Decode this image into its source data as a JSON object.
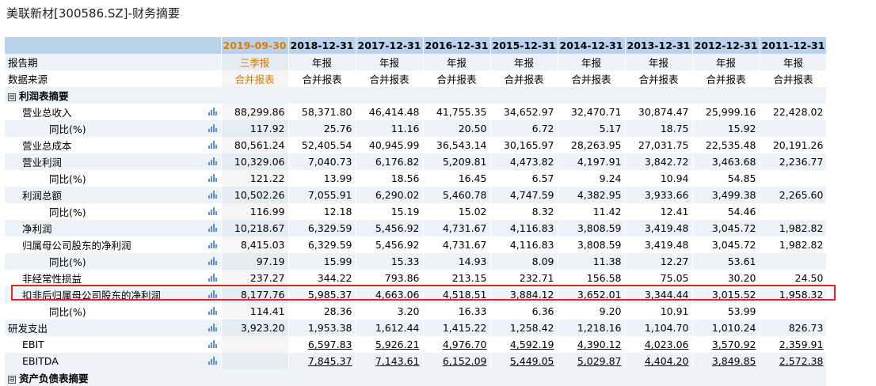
{
  "title": "美联新材[300586.SZ]-财务摘要",
  "columns": {
    "dates": [
      "2019-09-30",
      "2018-12-31",
      "2017-12-31",
      "2016-12-31",
      "2015-12-31",
      "2014-12-31",
      "2013-12-31",
      "2012-12-31",
      "2011-12-31"
    ],
    "report_label": "报告期",
    "report_types": [
      "三季报",
      "年报",
      "年报",
      "年报",
      "年报",
      "年报",
      "年报",
      "年报",
      "年报"
    ],
    "source_label": "数据来源",
    "sources": [
      "合并报表",
      "合并报表",
      "合并报表",
      "合并报表",
      "合并报表",
      "合并报表",
      "合并报表",
      "合并报表",
      "合并报表"
    ]
  },
  "sections": {
    "income": "利润表摘要",
    "balance": "资产负债表摘要"
  },
  "toggle_symbol": "⊟",
  "rows": [
    {
      "label": "营业总收入",
      "values": [
        "88,299.86",
        "58,371.80",
        "46,414.48",
        "41,755.35",
        "34,652.97",
        "32,470.71",
        "30,874.47",
        "25,999.16",
        "22,428.02"
      ]
    },
    {
      "label": "同比(%)",
      "values": [
        "117.92",
        "25.76",
        "11.16",
        "20.50",
        "6.72",
        "5.17",
        "18.75",
        "15.92",
        ""
      ]
    },
    {
      "label": "营业总成本",
      "values": [
        "80,561.24",
        "52,405.54",
        "40,945.99",
        "36,543.14",
        "30,165.97",
        "28,263.95",
        "27,031.75",
        "22,535.48",
        "20,191.26"
      ]
    },
    {
      "label": "营业利润",
      "values": [
        "10,329.06",
        "7,040.73",
        "6,176.82",
        "5,209.81",
        "4,473.82",
        "4,197.91",
        "3,842.72",
        "3,463.68",
        "2,236.77"
      ]
    },
    {
      "label": "同比(%)",
      "values": [
        "121.22",
        "13.99",
        "18.56",
        "16.45",
        "6.57",
        "9.24",
        "10.94",
        "54.85",
        ""
      ]
    },
    {
      "label": "利润总额",
      "values": [
        "10,502.26",
        "7,055.91",
        "6,290.02",
        "5,460.78",
        "4,747.59",
        "4,382.95",
        "3,933.66",
        "3,499.38",
        "2,265.60"
      ]
    },
    {
      "label": "同比(%)",
      "values": [
        "116.99",
        "12.18",
        "15.19",
        "15.02",
        "8.32",
        "11.42",
        "12.41",
        "54.46",
        ""
      ]
    },
    {
      "label": "净利润",
      "values": [
        "10,218.67",
        "6,329.59",
        "5,456.92",
        "4,731.67",
        "4,116.83",
        "3,808.59",
        "3,419.48",
        "3,045.72",
        "1,982.82"
      ]
    },
    {
      "label": "归属母公司股东的净利润",
      "values": [
        "8,415.03",
        "6,329.59",
        "5,456.92",
        "4,731.67",
        "4,116.83",
        "3,808.59",
        "3,419.48",
        "3,045.72",
        "1,982.82"
      ]
    },
    {
      "label": "同比(%)",
      "values": [
        "97.19",
        "15.99",
        "15.33",
        "14.93",
        "8.09",
        "11.38",
        "12.27",
        "53.61",
        ""
      ]
    },
    {
      "label": "非经常性损益",
      "values": [
        "237.27",
        "344.22",
        "793.86",
        "213.15",
        "232.71",
        "156.58",
        "75.05",
        "30.20",
        "24.50"
      ]
    },
    {
      "label": "扣非后归属母公司股东的净利润",
      "values": [
        "8,177.76",
        "5,985.37",
        "4,663.06",
        "4,518.51",
        "3,884.12",
        "3,652.01",
        "3,344.44",
        "3,015.52",
        "1,958.32"
      ]
    },
    {
      "label": "同比(%)",
      "values": [
        "114.41",
        "28.36",
        "3.20",
        "16.33",
        "6.36",
        "9.20",
        "10.91",
        "53.99",
        ""
      ]
    },
    {
      "label": "研发支出",
      "values": [
        "3,923.20",
        "1,953.38",
        "1,612.44",
        "1,415.22",
        "1,258.42",
        "1,218.16",
        "1,104.70",
        "1,010.24",
        "826.73"
      ]
    },
    {
      "label": "EBIT",
      "values": [
        "",
        "6,597.83",
        "5,926.21",
        "4,976.70",
        "4,592.19",
        "4,390.12",
        "4,023.06",
        "3,570.92",
        "2,359.91"
      ]
    },
    {
      "label": "EBITDA",
      "values": [
        "",
        "7,845.37",
        "7,143.61",
        "6,152.09",
        "5,449.05",
        "5,029.87",
        "4,404.20",
        "3,849.85",
        "2,572.38"
      ]
    }
  ]
}
